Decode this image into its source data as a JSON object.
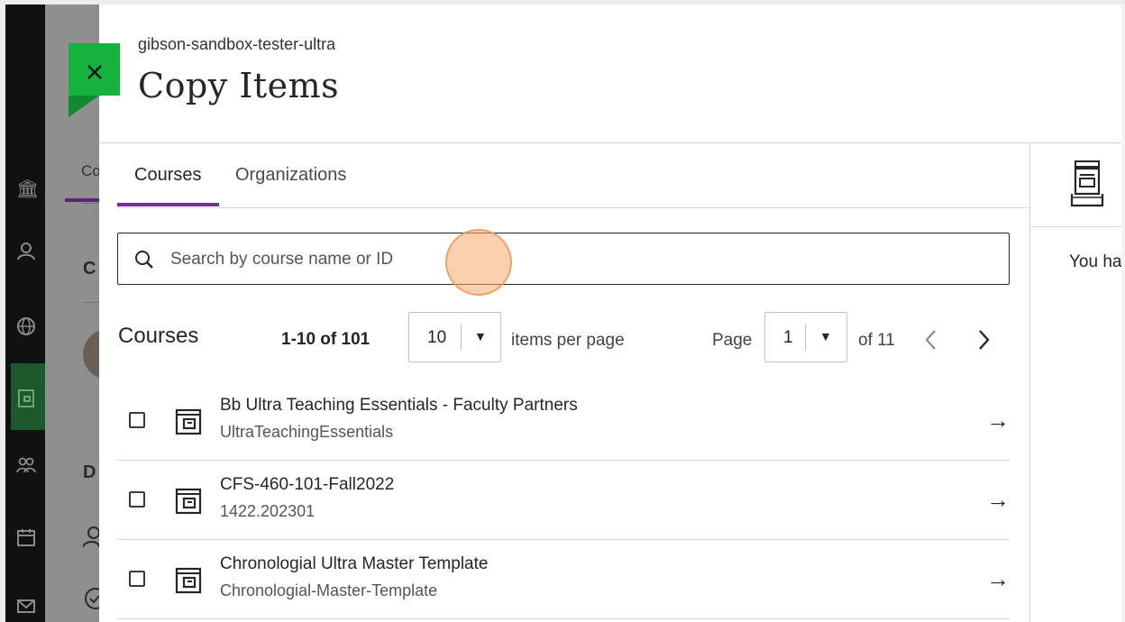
{
  "header": {
    "subtitle": "gibson-sandbox-tester-ultra",
    "title": "Copy Items",
    "close_icon": "close-icon"
  },
  "tabs": [
    {
      "label": "Courses",
      "active": true
    },
    {
      "label": "Organizations",
      "active": false
    }
  ],
  "search": {
    "placeholder": "Search by course name or ID",
    "value": ""
  },
  "list": {
    "heading": "Courses",
    "range": "1-10 of 101",
    "per_page_value": "10",
    "per_page_label": "items per page",
    "page_label": "Page",
    "page_value": "1",
    "page_total": "of 11"
  },
  "courses": [
    {
      "name": "Bb Ultra Teaching Essentials - Faculty Partners",
      "id": "UltraTeachingEssentials"
    },
    {
      "name": "CFS-460-101-Fall2022",
      "id": "1422.202301"
    },
    {
      "name": "Chronologial Ultra Master Template",
      "id": "Chronologial-Master-Template"
    }
  ],
  "side_panel": {
    "text": "You ha",
    "icon": "inbox-tray-icon"
  },
  "background": {
    "tab_fragment": "Co",
    "heading_fragment_1": "C",
    "heading_fragment_2": "D"
  },
  "colors": {
    "accent_purple": "#7a2da0",
    "close_green": "#15b33e",
    "nav_active_green": "#1a5a2c"
  }
}
